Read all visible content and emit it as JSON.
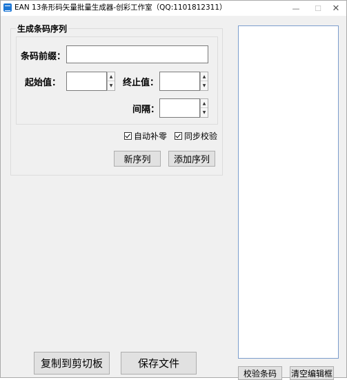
{
  "window": {
    "title": "EAN 13条形码矢量批量生成器-创彩工作室（QQ:1101812311）",
    "minimize_glyph": "—",
    "maximize_glyph": "☐",
    "close_glyph": "✕"
  },
  "group": {
    "title": "生成条码序列",
    "prefix_label": "条码前缀：",
    "prefix_value": "",
    "start_label": "起始值：",
    "start_value": "",
    "end_label": "终止值：",
    "end_value": "",
    "interval_label": "间隔：",
    "interval_value": "",
    "auto_pad_label": "自动补零",
    "auto_pad_checked": true,
    "sync_check_label": "同步校验",
    "sync_check_checked": true,
    "new_sequence_label": "新序列",
    "add_sequence_label": "添加序列"
  },
  "bottom": {
    "copy_label": "复制到剪切板",
    "save_label": "保存文件",
    "verify_label": "校验条码",
    "clear_label": "清空编辑框"
  },
  "output": {
    "value": ""
  },
  "colors": {
    "accent": "#1e78d6",
    "panel_bg": "#f0f0f0",
    "button_bg": "#e1e1e1"
  }
}
